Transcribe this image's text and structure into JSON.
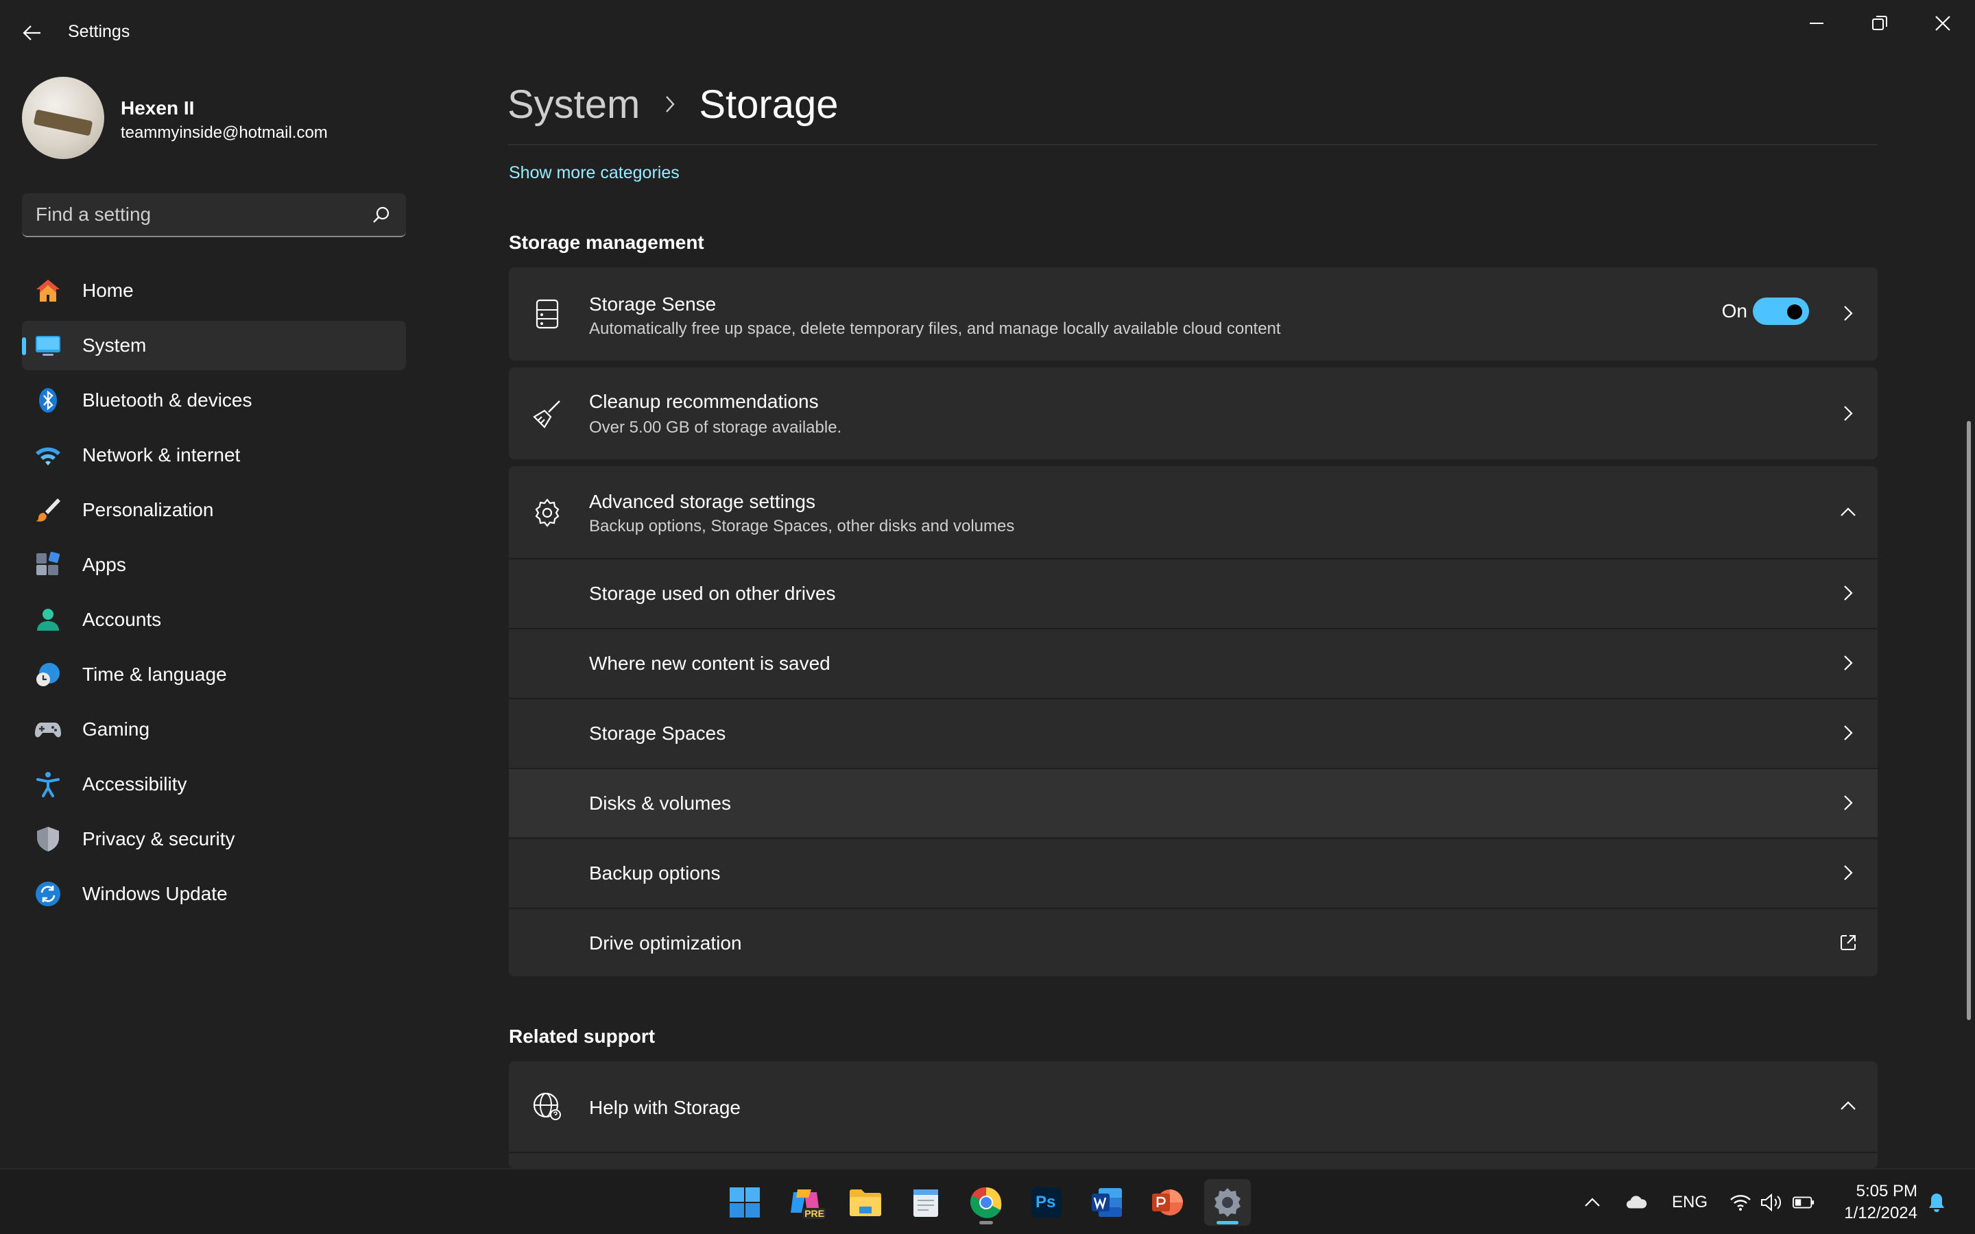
{
  "window": {
    "title": "Settings"
  },
  "profile": {
    "name": "Hexen II",
    "email": "teammyinside@hotmail.com"
  },
  "search": {
    "placeholder": "Find a setting"
  },
  "nav": {
    "items": [
      {
        "label": "Home",
        "icon": "home-icon",
        "active": false
      },
      {
        "label": "System",
        "icon": "monitor-icon",
        "active": true
      },
      {
        "label": "Bluetooth & devices",
        "icon": "bluetooth-icon",
        "active": false
      },
      {
        "label": "Network & internet",
        "icon": "wifi-icon",
        "active": false
      },
      {
        "label": "Personalization",
        "icon": "brush-icon",
        "active": false
      },
      {
        "label": "Apps",
        "icon": "apps-icon",
        "active": false
      },
      {
        "label": "Accounts",
        "icon": "person-icon",
        "active": false
      },
      {
        "label": "Time & language",
        "icon": "globe-clock-icon",
        "active": false
      },
      {
        "label": "Gaming",
        "icon": "gamepad-icon",
        "active": false
      },
      {
        "label": "Accessibility",
        "icon": "accessibility-icon",
        "active": false
      },
      {
        "label": "Privacy & security",
        "icon": "shield-icon",
        "active": false
      },
      {
        "label": "Windows Update",
        "icon": "update-icon",
        "active": false
      }
    ]
  },
  "breadcrumb": {
    "parent": "System",
    "current": "Storage"
  },
  "show_more": "Show more categories",
  "storage_management": {
    "title": "Storage management",
    "storage_sense": {
      "title": "Storage Sense",
      "subtitle": "Automatically free up space, delete temporary files, and manage locally available cloud content",
      "toggle_label": "On",
      "toggle_on": true
    },
    "cleanup": {
      "title": "Cleanup recommendations",
      "subtitle": "Over 5.00 GB of storage available."
    },
    "advanced": {
      "title": "Advanced storage settings",
      "subtitle": "Backup options, Storage Spaces, other disks and volumes",
      "expanded": true,
      "items": [
        {
          "label": "Storage used on other drives",
          "action": "chevron"
        },
        {
          "label": "Where new content is saved",
          "action": "chevron"
        },
        {
          "label": "Storage Spaces",
          "action": "chevron"
        },
        {
          "label": "Disks & volumes",
          "action": "chevron"
        },
        {
          "label": "Backup options",
          "action": "chevron"
        },
        {
          "label": "Drive optimization",
          "action": "external-link"
        }
      ]
    }
  },
  "related_support": {
    "title": "Related support",
    "help": {
      "title": "Help with Storage",
      "expanded": true
    }
  },
  "taskbar": {
    "apps": [
      "windows-start-icon",
      "copilot-icon",
      "file-explorer-icon",
      "notepad-icon",
      "chrome-icon",
      "photoshop-icon",
      "word-icon",
      "powerpoint-icon",
      "settings-icon"
    ],
    "photoshop_label": "Ps",
    "copilot_badge": "PRE",
    "tray": {
      "language": "ENG",
      "time": "5:05 PM",
      "date": "1/12/2024"
    }
  },
  "colors": {
    "accent": "#4cc2ff",
    "link": "#99ebff",
    "background": "#202020",
    "card": "#2b2b2b"
  }
}
